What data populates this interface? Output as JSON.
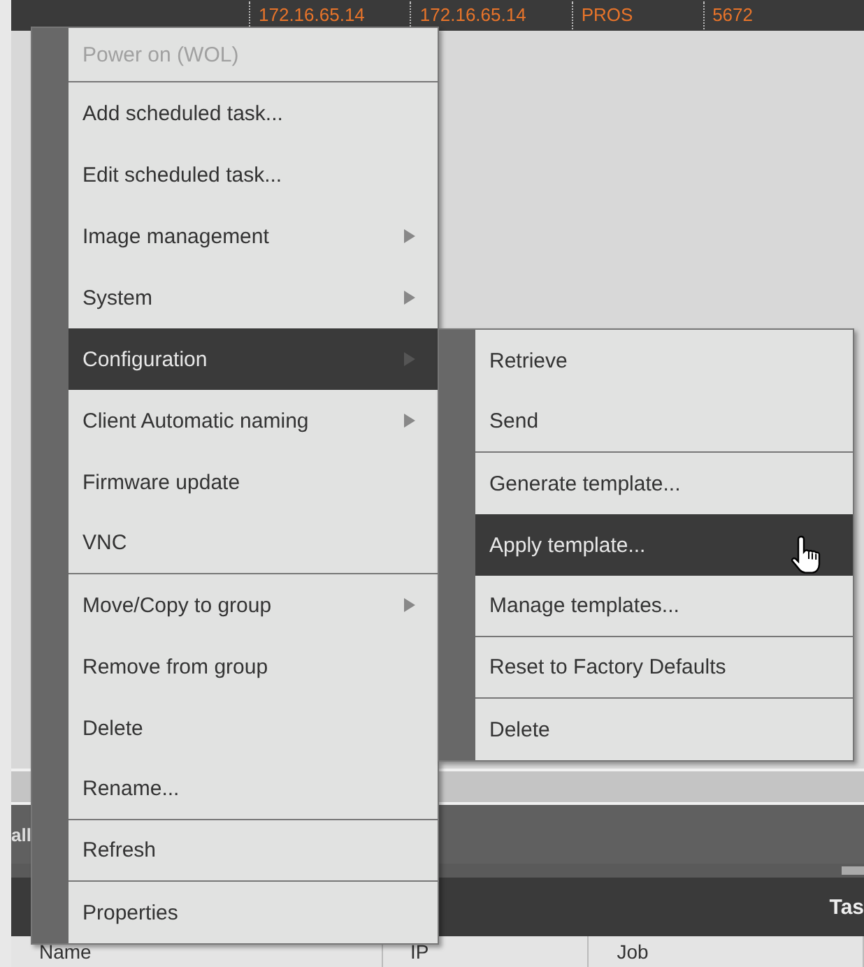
{
  "table_top_row": {
    "cells": [
      "172.16.65.14",
      "172.16.65.14",
      "PROS",
      "5672"
    ]
  },
  "lower_panel": {
    "tab_label": "all",
    "section_title": "Tas",
    "columns": [
      "Name",
      "IP",
      "Job"
    ]
  },
  "context_menu": {
    "items": [
      {
        "label": "Power on (WOL)",
        "disabled": true,
        "submenu": false,
        "selected": false,
        "separator_after": true
      },
      {
        "label": "Add scheduled task...",
        "disabled": false,
        "submenu": false,
        "selected": false,
        "separator_after": false
      },
      {
        "label": "Edit scheduled task...",
        "disabled": false,
        "submenu": false,
        "selected": false,
        "separator_after": false
      },
      {
        "label": "Image management",
        "disabled": false,
        "submenu": true,
        "selected": false,
        "separator_after": false
      },
      {
        "label": "System",
        "disabled": false,
        "submenu": true,
        "selected": false,
        "separator_after": false
      },
      {
        "label": "Configuration",
        "disabled": false,
        "submenu": true,
        "selected": true,
        "separator_after": false
      },
      {
        "label": "Client Automatic naming",
        "disabled": false,
        "submenu": true,
        "selected": false,
        "separator_after": false
      },
      {
        "label": "Firmware update",
        "disabled": false,
        "submenu": false,
        "selected": false,
        "separator_after": false
      },
      {
        "label": "VNC",
        "disabled": false,
        "submenu": false,
        "selected": false,
        "separator_after": true
      },
      {
        "label": "Move/Copy to group",
        "disabled": false,
        "submenu": true,
        "selected": false,
        "separator_after": false
      },
      {
        "label": "Remove from group",
        "disabled": false,
        "submenu": false,
        "selected": false,
        "separator_after": false
      },
      {
        "label": "Delete",
        "disabled": false,
        "submenu": false,
        "selected": false,
        "separator_after": false
      },
      {
        "label": "Rename...",
        "disabled": false,
        "submenu": false,
        "selected": false,
        "separator_after": true
      },
      {
        "label": "Refresh",
        "disabled": false,
        "submenu": false,
        "selected": false,
        "separator_after": true
      },
      {
        "label": "Properties",
        "disabled": false,
        "submenu": false,
        "selected": false,
        "separator_after": false
      }
    ]
  },
  "submenu": {
    "items": [
      {
        "label": "Retrieve",
        "selected": false,
        "separator_after": false
      },
      {
        "label": "Send",
        "selected": false,
        "separator_after": true
      },
      {
        "label": "Generate template...",
        "selected": false,
        "separator_after": false
      },
      {
        "label": "Apply template...",
        "selected": true,
        "separator_after": false
      },
      {
        "label": "Manage templates...",
        "selected": false,
        "separator_after": true
      },
      {
        "label": "Reset to Factory Defaults",
        "selected": false,
        "separator_after": true
      },
      {
        "label": "Delete",
        "selected": false,
        "separator_after": false
      }
    ]
  }
}
